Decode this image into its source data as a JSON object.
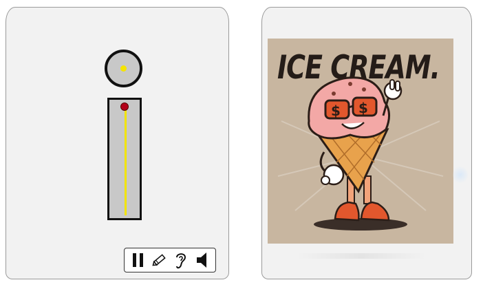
{
  "left_panel": {
    "toolbar": {
      "pause_icon": "pause-icon",
      "edit_icon": "pencil-icon",
      "listen_icon": "ear-icon",
      "audio_icon": "speaker-icon"
    },
    "info_icon": "info-icon",
    "colors": {
      "fill": "#c8c8c8",
      "outline": "#111111",
      "accent": "#f2e400",
      "knob": "#b3001a"
    }
  },
  "right_panel": {
    "image": {
      "title": "ICE CREAM.",
      "background_color": "#c8b6a0"
    }
  }
}
